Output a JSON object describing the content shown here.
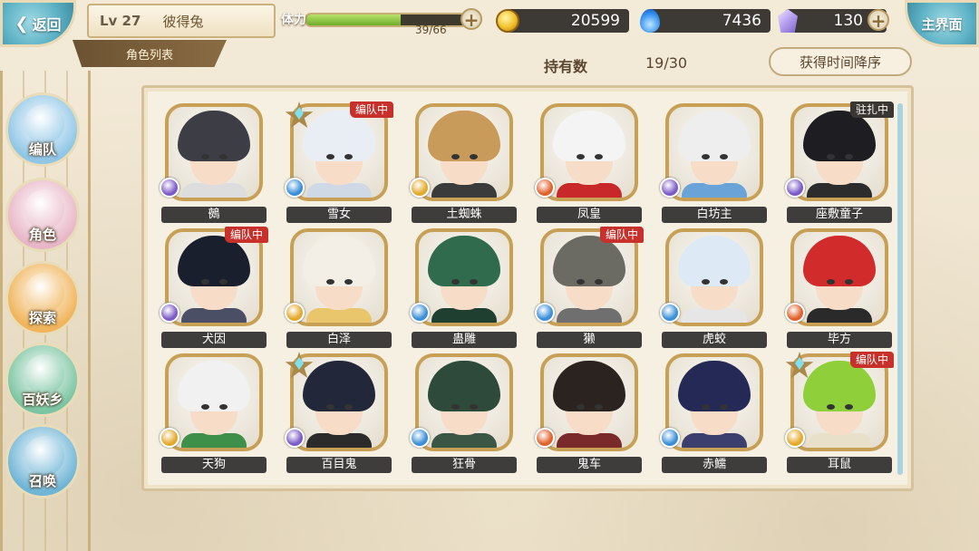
{
  "header": {
    "back_label": "返回",
    "level": "Lv 27",
    "player_name": "彼得兔",
    "roster_tab": "角色列表",
    "stamina_label": "体力",
    "stamina_text": "39/66",
    "stamina_fraction": 0.59,
    "gold": "20599",
    "soul": "7436",
    "gems": "130",
    "home_label": "主界面"
  },
  "toolbar": {
    "owned_label": "持有数",
    "owned_value": "19/30",
    "sort_label": "获得时间降序"
  },
  "sidebar": {
    "items": [
      {
        "label": "编队",
        "icon": "team-icon",
        "color": "#8fc6e6"
      },
      {
        "label": "角色",
        "icon": "character-icon",
        "color": "#e8b7c7"
      },
      {
        "label": "探索",
        "icon": "explore-icon",
        "color": "#f0b45a"
      },
      {
        "label": "百妖乡",
        "icon": "village-icon",
        "color": "#7cc5a2"
      },
      {
        "label": "召唤",
        "icon": "summon-icon",
        "color": "#6fb5d6"
      }
    ]
  },
  "characters": [
    {
      "name": "鵺",
      "badge": "",
      "star": false,
      "element": "purple",
      "hair": "#3d3d45",
      "outfit": "#ddd"
    },
    {
      "name": "雪女",
      "badge": "编队中",
      "star": true,
      "element": "blue",
      "hair": "#e9eef5",
      "outfit": "#cfd8e5"
    },
    {
      "name": "土蜘蛛",
      "badge": "",
      "star": false,
      "element": "yellow",
      "hair": "#c89b5a",
      "outfit": "#3b3b3b"
    },
    {
      "name": "凤皇",
      "badge": "",
      "star": false,
      "element": "orange",
      "hair": "#f4f4f4",
      "outfit": "#c8282a"
    },
    {
      "name": "白坊主",
      "badge": "",
      "star": false,
      "element": "purple",
      "hair": "#eeeeee",
      "outfit": "#6aa3d8"
    },
    {
      "name": "座敷童子",
      "badge": "驻扎中",
      "star": false,
      "element": "purple",
      "hair": "#1d1d22",
      "outfit": "#2c2c2c"
    },
    {
      "name": "犬因",
      "badge": "编队中",
      "star": false,
      "element": "purple",
      "hair": "#1a1f2e",
      "outfit": "#4a4f66"
    },
    {
      "name": "白泽",
      "badge": "",
      "star": false,
      "element": "yellow",
      "hair": "#f4efe6",
      "outfit": "#e9c56b"
    },
    {
      "name": "蛊雕",
      "badge": "",
      "star": false,
      "element": "blue",
      "hair": "#2f6b4c",
      "outfit": "#1f3f30"
    },
    {
      "name": "獭",
      "badge": "编队中",
      "star": false,
      "element": "blue",
      "hair": "#6b6b63",
      "outfit": "#6f6f6f"
    },
    {
      "name": "虎蛟",
      "badge": "",
      "star": false,
      "element": "blue",
      "hair": "#dde9f5",
      "outfit": "#e6e6e6"
    },
    {
      "name": "毕方",
      "badge": "",
      "star": false,
      "element": "orange",
      "hair": "#d12b2b",
      "outfit": "#2a2a2a"
    },
    {
      "name": "天狗",
      "badge": "",
      "star": false,
      "element": "yellow",
      "hair": "#f1f1f1",
      "outfit": "#3d8f4a"
    },
    {
      "name": "百目鬼",
      "badge": "",
      "star": true,
      "element": "purple",
      "hair": "#22273a",
      "outfit": "#2b2b2b"
    },
    {
      "name": "狂骨",
      "badge": "",
      "star": false,
      "element": "blue",
      "hair": "#2e4a3a",
      "outfit": "#3c5646"
    },
    {
      "name": "鬼车",
      "badge": "",
      "star": false,
      "element": "orange",
      "hair": "#2a2320",
      "outfit": "#7a2a2a"
    },
    {
      "name": "赤鱬",
      "badge": "",
      "star": false,
      "element": "blue",
      "hair": "#242a55",
      "outfit": "#3b3f6e"
    },
    {
      "name": "耳鼠",
      "badge": "编队中",
      "star": true,
      "element": "yellow",
      "hair": "#8fcf3a",
      "outfit": "#e8e0c8"
    }
  ],
  "element_colors": {
    "purple": "#7d5bc7",
    "blue": "#3a8fd8",
    "yellow": "#e3a92a",
    "orange": "#e0612a"
  }
}
